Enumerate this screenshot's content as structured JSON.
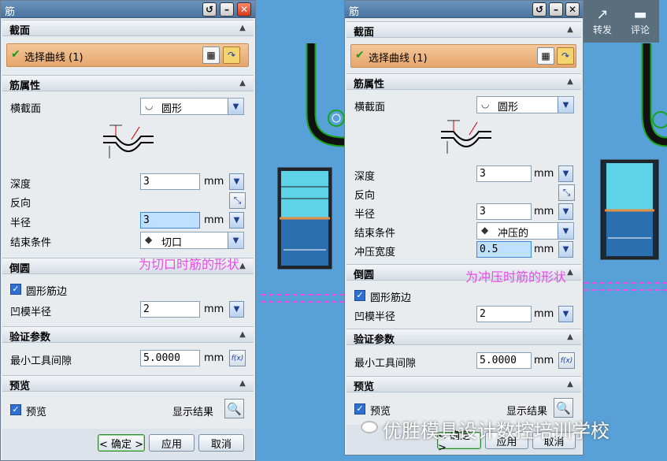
{
  "left": {
    "title": "筋",
    "sections": {
      "section": "截面",
      "rib_props": "筋属性",
      "fillet": "倒圆",
      "verify": "验证参数",
      "preview": "预览"
    },
    "select_curve": "选择曲线 (1)",
    "cross_section_label": "横截面",
    "cross_section_value": "圆形",
    "depth_label": "深度",
    "depth_value": "3",
    "depth_unit": "mm",
    "reverse_label": "反向",
    "radius_label": "半径",
    "radius_value": "3",
    "radius_unit": "mm",
    "end_label": "结束条件",
    "end_value": "切口",
    "round_edge_label": "圆形筋边",
    "die_radius_label": "凹模半径",
    "die_radius_value": "2",
    "die_radius_unit": "mm",
    "min_gap_label": "最小工具间隙",
    "min_gap_value": "5.0000",
    "min_gap_unit": "mm",
    "preview_label": "预览",
    "show_result_label": "显示结果",
    "ok": "< 确定 >",
    "apply": "应用",
    "cancel": "取消"
  },
  "right": {
    "title": "筋",
    "sections": {
      "section": "截面",
      "rib_props": "筋属性",
      "fillet": "倒圆",
      "verify": "验证参数",
      "preview": "预览"
    },
    "select_curve": "选择曲线 (1)",
    "cross_section_label": "横截面",
    "cross_section_value": "圆形",
    "depth_label": "深度",
    "depth_value": "3",
    "depth_unit": "mm",
    "reverse_label": "反向",
    "radius_label": "半径",
    "radius_value": "3",
    "radius_unit": "mm",
    "end_label": "结束条件",
    "end_value": "冲压的",
    "stamp_width_label": "冲压宽度",
    "stamp_width_value": "0.5",
    "stamp_width_unit": "mm",
    "round_edge_label": "圆形筋边",
    "die_radius_label": "凹模半径",
    "die_radius_value": "2",
    "die_radius_unit": "mm",
    "min_gap_label": "最小工具间隙",
    "min_gap_value": "5.0000",
    "min_gap_unit": "mm",
    "preview_label": "预览",
    "show_result_label": "显示结果",
    "ok": "< 确定 >",
    "apply": "应用",
    "cancel": "取消"
  },
  "annotations": {
    "cut": "为切口时筋的形状",
    "stamp": "为冲压时筋的形状"
  },
  "overlay": {
    "share": "转发",
    "comment": "评论",
    "watermark": "优胜模具设计数控培训学校"
  },
  "colors": {
    "background": "#58a0d8",
    "annotation": "#e84ce8",
    "selection": "#e5a66c"
  }
}
